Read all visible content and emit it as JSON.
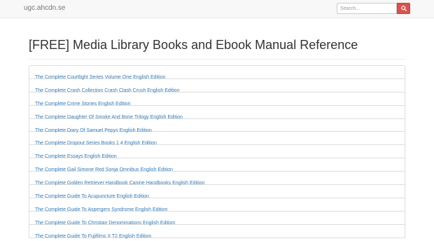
{
  "navbar": {
    "brand": "ugc.ahcdn.se",
    "search_placeholder": "Search...",
    "search_icon": "search-icon"
  },
  "page": {
    "title": "[FREE] Media Library Books and Ebook Manual Reference"
  },
  "books": [
    "The Complete Courtlight Series Volume One English Edition",
    "The Complete Crash Collection Crash Clash Crush English Edition",
    "The Complete Crime Stories English Edition",
    "The Complete Daughter Of Smoke And Bone Trilogy English Edition",
    "The Complete Diary Of Samuel Pepys English Edition",
    "The Complete Dropout Series Books 1 4 English Edition",
    "The Complete Essays English Edition",
    "The Complete Gail Simone Red Sonja Omnibus English Edition",
    "The Complete Golden Retriever Handbook Canine Handbooks English Edition",
    "The Complete Guide To Acupuncture English Edition",
    "The Complete Guide To Aspergers Syndrome English Edition",
    "The Complete Guide To Christian Denominations English Edition",
    "The Complete Guide To Fujifilms X T2 English Edition"
  ],
  "colors": {
    "link": "#337ab7",
    "search_button": "#d9534f",
    "navbar_bg": "#f8f8f8"
  }
}
